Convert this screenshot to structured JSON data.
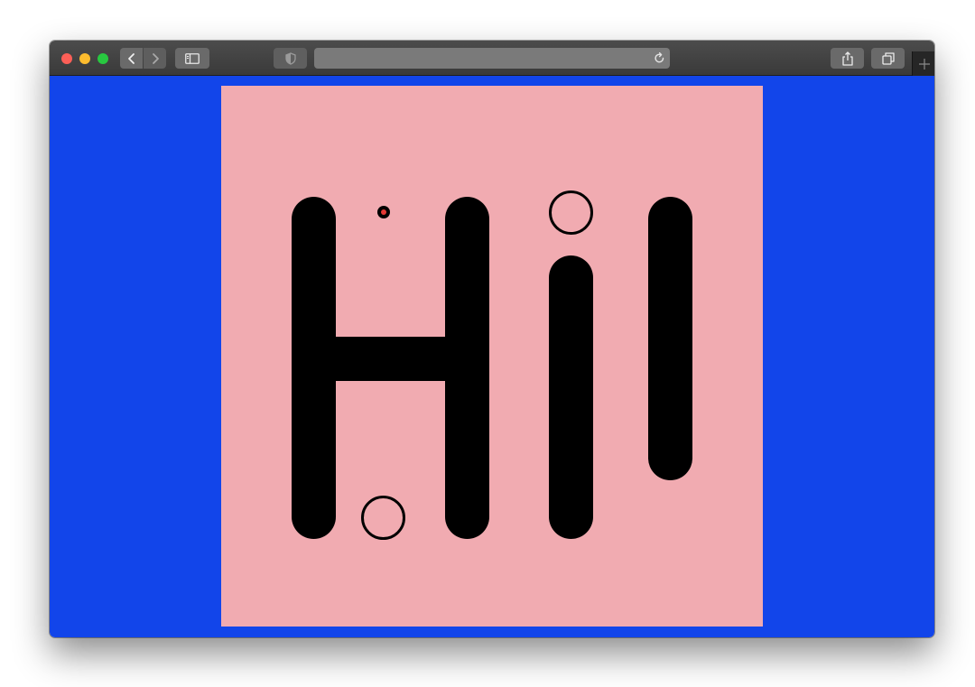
{
  "browser": {
    "traffic_lights": [
      "close-button",
      "minimize-button",
      "zoom-button"
    ],
    "address_bar": {
      "value": "",
      "placeholder": ""
    },
    "icons": {
      "back": "chevron-left-icon",
      "forward": "chevron-right-icon",
      "sidebar": "sidebar-icon",
      "privacy": "shield-icon",
      "reload": "reload-icon",
      "share": "share-icon",
      "tabs": "tabs-overview-icon",
      "new_tab": "plus-icon"
    }
  },
  "page": {
    "background_color": "#1245ea",
    "artboard_color": "#f1abb1",
    "glyph_color": "#000000",
    "dot_center_color": "#e53935",
    "depicted_text": "Hi!"
  }
}
